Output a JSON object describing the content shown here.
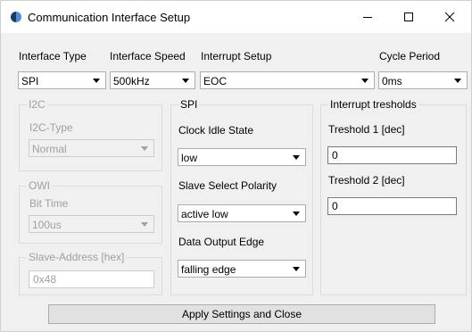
{
  "window": {
    "title": "Communication Interface Setup"
  },
  "top": {
    "interface_type": {
      "label": "Interface Type",
      "value": "SPI"
    },
    "interface_speed": {
      "label": "Interface Speed",
      "value": "500kHz"
    },
    "interrupt_setup": {
      "label": "Interrupt Setup",
      "value": "EOC"
    },
    "cycle_period": {
      "label": "Cycle Period",
      "value": "0ms"
    }
  },
  "i2c": {
    "title": "I2C",
    "type_label": "I2C-Type",
    "type_value": "Normal"
  },
  "owi": {
    "title": "OWI",
    "bit_time_label": "Bit Time",
    "bit_time_value": "100us"
  },
  "slave_address": {
    "title": "Slave-Address [hex]",
    "value": "0x48"
  },
  "spi": {
    "title": "SPI",
    "clock_idle_label": "Clock Idle State",
    "clock_idle_value": "low",
    "slave_select_label": "Slave Select Polarity",
    "slave_select_value": "active low",
    "data_output_label": "Data Output Edge",
    "data_output_value": "falling edge"
  },
  "interrupt": {
    "title": "Interrupt tresholds",
    "t1_label": "Treshold 1 [dec]",
    "t1_value": "0",
    "t2_label": "Treshold 2 [dec]",
    "t2_value": "0"
  },
  "apply_button": "Apply Settings and Close"
}
